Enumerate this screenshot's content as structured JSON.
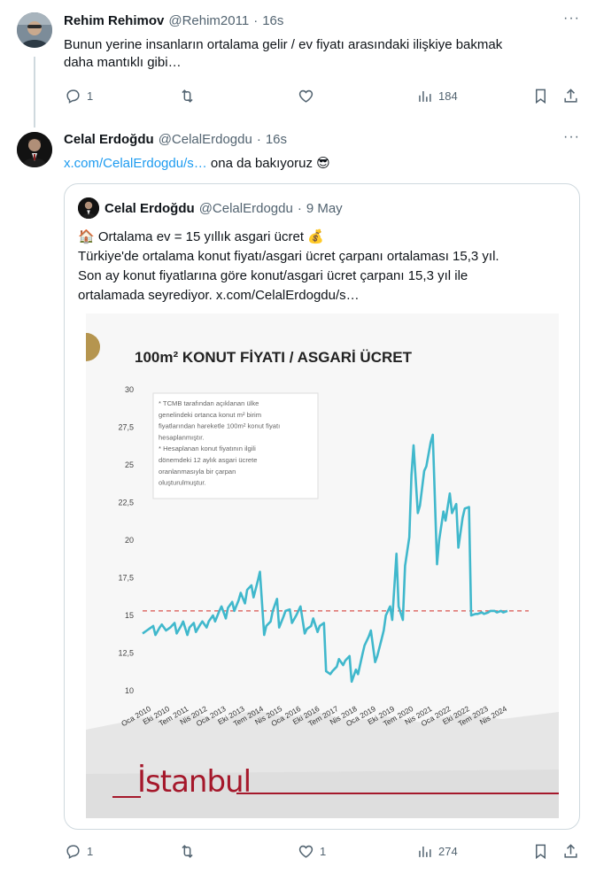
{
  "tweet1": {
    "name": "Rehim Rehimov",
    "handle": "@Rehim2011",
    "dot": "·",
    "time": "16s",
    "text_line1": "Bunun yerine insanların ortalama gelir / ev fiyatı arasındaki ilişkiye bakmak",
    "text_line2": "daha mantıklı gibi…",
    "replies": "1",
    "retweets": "",
    "likes": "",
    "views": "184"
  },
  "tweet2": {
    "name": "Celal Erdoğdu",
    "handle": "@CelalErdogdu",
    "dot": "·",
    "time": "16s",
    "link": "x.com/CelalErdogdu/s…",
    "text": " ona da bakıyoruz 😎",
    "replies": "1",
    "retweets": "",
    "likes": "1",
    "views": "274"
  },
  "quote": {
    "name": "Celal Erdoğdu",
    "handle": "@CelalErdogdu",
    "dot": "·",
    "date": "9 May",
    "line1": "🏠 Ortalama ev = 15 yıllık asgari ücret 💰",
    "line2": "Türkiye'de ortalama konut fiyatı/asgari ücret çarpanı ortalaması 15,3 yıl.",
    "line3": "Son ay konut fiyatlarına göre konut/asgari ücret çarpanı 15,3 yıl ile",
    "line4": "ortalamada seyrediyor.  x.com/CelalErdogdu/s…"
  },
  "chart_data": {
    "type": "line",
    "title": "100m² KONUT FİYATI / ASGARİ ÜCRET",
    "ylim": [
      10,
      30
    ],
    "yticks": [
      "30",
      "27,5",
      "25",
      "22,5",
      "20",
      "17,5",
      "15",
      "12,5",
      "10"
    ],
    "xticks": [
      "Oca 2010",
      "Eki 2010",
      "Tem 2011",
      "Nis 2012",
      "Oca 2013",
      "Eki 2013",
      "Tem 2014",
      "Nis 2015",
      "Oca 2016",
      "Eki 2016",
      "Tem 2017",
      "Nis 2018",
      "Oca 2019",
      "Eki 2019",
      "Tem 2020",
      "Nis 2021",
      "Oca 2022",
      "Eki 2022",
      "Tem 2023",
      "Nis 2024"
    ],
    "average_line": 15.3,
    "note_lines": [
      "* TCMB tarafından açıklanan ülke",
      "genelindeki ortanca konut m² birim",
      "fiyatlarından hareketle 100m² konut fiyatı",
      "hesaplanmıştır.",
      "* Hesaplanan konut fiyatının ilgili",
      "dönemdeki 12 aylık asgari ücrete",
      "oranlanmasıyla bir çarpan",
      "oluşturulmuştur."
    ],
    "series": [
      {
        "color": "#40b8cc",
        "x": [
          0,
          2,
          3,
          5,
          6,
          8,
          9,
          11,
          12,
          13,
          15,
          16,
          18,
          19,
          21,
          22,
          24,
          25,
          27,
          28,
          30,
          31,
          33,
          34,
          36,
          37,
          39,
          40,
          42,
          43,
          45,
          46,
          48,
          49,
          51,
          52,
          54,
          55,
          57,
          58,
          60,
          61,
          63,
          64,
          66,
          67,
          69,
          70,
          72,
          73,
          74,
          76,
          77,
          79,
          80,
          82,
          83,
          85,
          86,
          88,
          89,
          91,
          92,
          94,
          95,
          97,
          98,
          100,
          101,
          103,
          104,
          106,
          107,
          109,
          110,
          112,
          113,
          114,
          116,
          117,
          119,
          120,
          122,
          123,
          125,
          126,
          127,
          129,
          130,
          132,
          133,
          135,
          136,
          138,
          139,
          141,
          142,
          144,
          145,
          147,
          148,
          150,
          151,
          153,
          154,
          156,
          157,
          159,
          160,
          162,
          163,
          165,
          166,
          168,
          169,
          171
        ],
        "y": [
          13.8,
          14.0,
          14.1,
          14.3,
          13.7,
          14.2,
          14.4,
          14.0,
          14.1,
          14.2,
          14.5,
          13.8,
          14.3,
          14.6,
          13.7,
          14.2,
          14.5,
          13.9,
          14.4,
          14.6,
          14.2,
          14.6,
          15.0,
          14.6,
          15.3,
          15.6,
          14.8,
          15.5,
          15.9,
          15.3,
          16.0,
          16.5,
          15.8,
          16.7,
          17.0,
          16.2,
          17.3,
          17.9,
          13.7,
          14.3,
          14.6,
          15.3,
          16.1,
          14.2,
          14.9,
          15.3,
          15.4,
          14.5,
          15.0,
          15.3,
          15.6,
          13.8,
          14.1,
          14.3,
          14.8,
          13.9,
          14.3,
          14.5,
          11.3,
          11.1,
          11.3,
          11.6,
          12.1,
          11.7,
          12.0,
          12.3,
          10.6,
          11.4,
          11.1,
          12.4,
          13.0,
          13.6,
          14.0,
          11.9,
          12.3,
          13.4,
          14.0,
          15.0,
          15.6,
          14.7,
          19.1,
          15.6,
          14.7,
          18.3,
          20.2,
          24.3,
          26.3,
          21.8,
          22.3,
          24.6,
          24.9,
          26.5,
          27.0,
          18.4,
          20.0,
          21.9,
          21.3,
          23.1,
          21.8,
          22.4,
          19.5,
          21.5,
          22.1,
          22.2,
          15.0,
          15.1,
          15.1,
          15.2,
          15.1,
          15.2,
          15.3,
          15.3,
          15.2,
          15.3,
          15.2,
          15.3
        ]
      }
    ]
  }
}
